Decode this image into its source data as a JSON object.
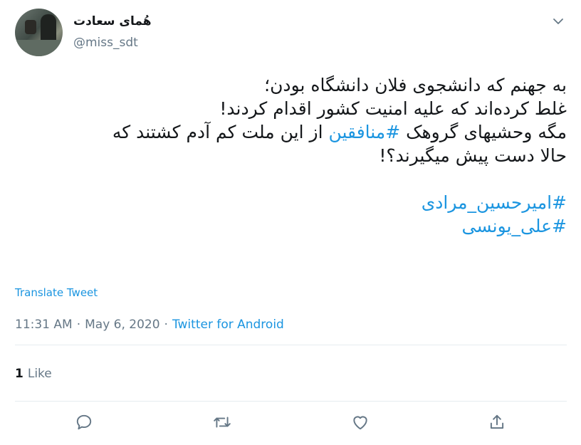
{
  "user": {
    "display_name": "هُمای سعادت",
    "handle": "@miss_sdt"
  },
  "tweet": {
    "lines": [
      "به جهنم که دانشجوی فلان دانشگاه بودن؛",
      "غلط کرده‌اند که علیه امنیت کشور اقدام کردند!",
      {
        "before": "مگه وحشیهای گروهک ",
        "hashtag": "#منافقین",
        "after": " از این ملت کم آدم کشتند که"
      },
      "حالا دست پیش میگیرند؟!"
    ],
    "hashtags": [
      "#امیرحسین_مرادی",
      "#علی_یونسی"
    ]
  },
  "translate_label": "Translate Tweet",
  "meta": {
    "time": "11:31 AM",
    "separator": "·",
    "date": "May 6, 2020",
    "source": "Twitter for Android"
  },
  "stats": {
    "likes_count": "1",
    "likes_label": "Like"
  },
  "icons": {
    "caret": "chevron-down-icon",
    "reply": "reply-icon",
    "retweet": "retweet-icon",
    "like": "heart-icon",
    "share": "share-icon"
  },
  "colors": {
    "text": "#14171a",
    "secondary": "#657786",
    "link": "#1b95e0",
    "divider": "#e6ecf0"
  }
}
